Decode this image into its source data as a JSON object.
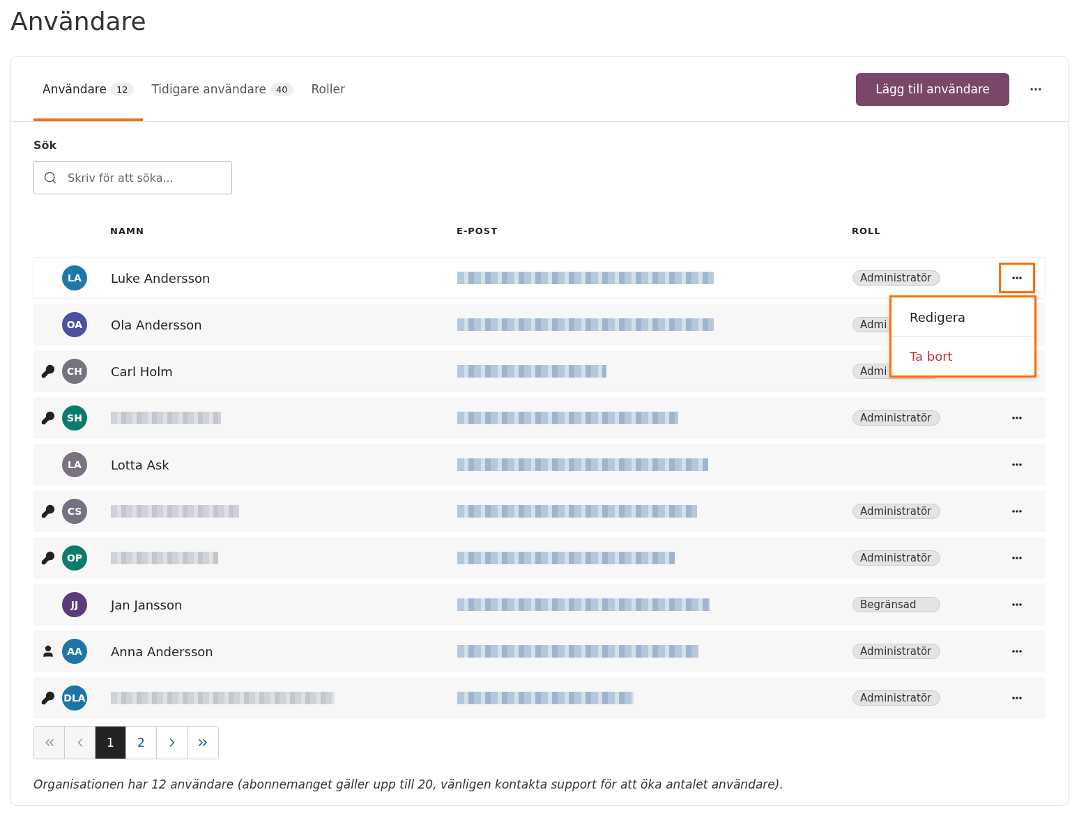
{
  "page_title": "Användare",
  "tabs": [
    {
      "label": "Användare",
      "count": "12",
      "selected": true
    },
    {
      "label": "Tidigare användare",
      "count": "40",
      "selected": false
    },
    {
      "label": "Roller",
      "selected": false
    }
  ],
  "add_button": "Lägg till användare",
  "search": {
    "label": "Sök",
    "placeholder": "Skriv för att söka..."
  },
  "table": {
    "columns": [
      "NAMN",
      "E-POST",
      "ROLL"
    ],
    "rows": [
      {
        "kind": "none",
        "initials": "LA",
        "color": "#1f78a8",
        "name": "Luke Andersson",
        "role": "Administratör",
        "menu": {
          "items": [
            {
              "label": "Redigera",
              "kind": "normal"
            },
            {
              "label": "Ta bort",
              "kind": "danger"
            }
          ]
        }
      },
      {
        "kind": "none",
        "initials": "OA",
        "color": "#4a50a3",
        "name": "Ola Andersson",
        "role": "Admi"
      },
      {
        "kind": "key",
        "initials": "CH",
        "color": "#77727f",
        "name": "Carl Holm",
        "role": "Admi"
      },
      {
        "kind": "key",
        "initials": "SH",
        "color": "#0d7b6b",
        "role": "Administratör"
      },
      {
        "kind": "none",
        "initials": "LA",
        "color": "#78737f",
        "name": "Lotta Ask"
      },
      {
        "kind": "key",
        "initials": "CS",
        "color": "#76717e",
        "role": "Administratör"
      },
      {
        "kind": "key",
        "initials": "OP",
        "color": "#0e7a6a",
        "role": "Administratör"
      },
      {
        "kind": "none",
        "initials": "JJ",
        "color": "#5b3b78",
        "name": "Jan Jansson",
        "role": "Begränsad"
      },
      {
        "kind": "person",
        "initials": "AA",
        "color": "#1e76a6",
        "name": "Anna Andersson",
        "role": "Administratör"
      },
      {
        "kind": "key",
        "initials": "DLA",
        "color": "#1d75a5",
        "role": "Administratör"
      }
    ]
  },
  "pagination": [
    {
      "kind": "first",
      "disabled": true,
      "selected": false
    },
    {
      "kind": "prev",
      "disabled": true,
      "selected": false
    },
    {
      "kind": "page",
      "label": "1",
      "selected": true,
      "disabled": false
    },
    {
      "kind": "page",
      "label": "2",
      "selected": false,
      "disabled": false
    },
    {
      "kind": "next",
      "disabled": false,
      "selected": false
    },
    {
      "kind": "last",
      "disabled": false,
      "selected": false
    }
  ],
  "footnote": "Organisationen har 12 användare (abonnemanget gäller upp till 20, vänligen kontakta support för att öka antalet användare)."
}
